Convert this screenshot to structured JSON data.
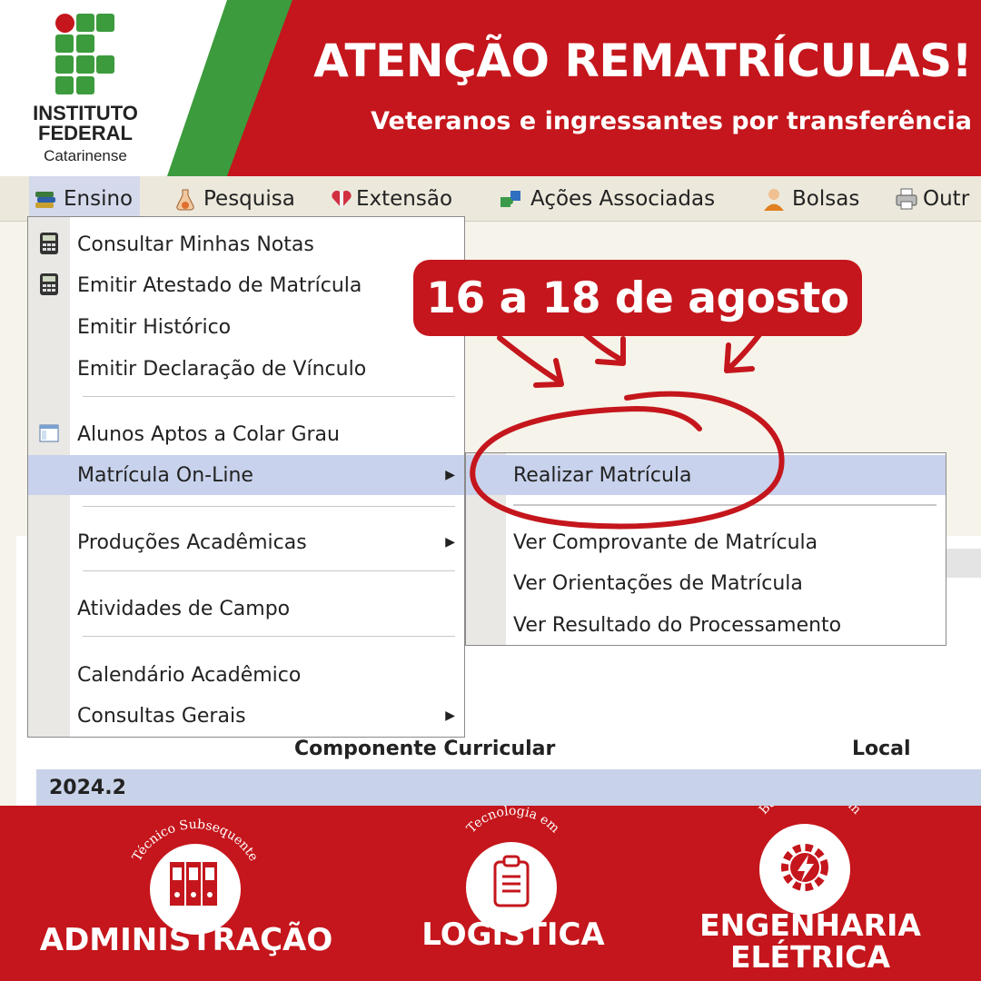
{
  "header": {
    "logo": {
      "line1": "INSTITUTO",
      "line2": "FEDERAL",
      "line3": "Catarinense"
    },
    "title": "ATENÇÃO REMATRÍCULAS!",
    "subtitle": "Veteranos e ingressantes por transferência"
  },
  "colors": {
    "brand_red": "#c4161c",
    "logo_green": "#3c9b3c",
    "menu_highlight": "#c8d2ec"
  },
  "menubar": {
    "items": [
      {
        "label": "Ensino",
        "icon": "books-icon"
      },
      {
        "label": "Pesquisa",
        "icon": "flask-icon"
      },
      {
        "label": "Extensão",
        "icon": "heart-gift-icon"
      },
      {
        "label": "Ações Associadas",
        "icon": "puzzle-icon"
      },
      {
        "label": "Bolsas",
        "icon": "person-icon"
      },
      {
        "label": "Outr",
        "icon": "printer-icon"
      }
    ]
  },
  "ensino_menu": {
    "items": [
      {
        "label": "Consultar Minhas Notas",
        "icon": "calculator-icon"
      },
      {
        "label": "Emitir Atestado de Matrícula",
        "icon": "calculator-icon"
      },
      {
        "label": "Emitir Histórico"
      },
      {
        "label": "Emitir Declaração de Vínculo"
      },
      {
        "label": "Alunos Aptos a Colar Grau",
        "icon": "window-icon"
      },
      {
        "label": "Matrícula On-Line",
        "has_submenu": true,
        "highlighted": true
      },
      {
        "label": "Produções Acadêmicas",
        "has_submenu": true
      },
      {
        "label": "Atividades de Campo"
      },
      {
        "label": "Calendário Acadêmico"
      },
      {
        "label": "Consultas Gerais",
        "has_submenu": true
      }
    ]
  },
  "matricula_submenu": {
    "items": [
      {
        "label": "Realizar Matrícula",
        "highlighted": true
      },
      {
        "label": "Ver Comprovante de Matrícula"
      },
      {
        "label": "Ver Orientações de Matrícula"
      },
      {
        "label": "Ver Resultado do Processamento"
      }
    ]
  },
  "date_badge": "16 a 18 de agosto",
  "table": {
    "columns": [
      "Componente Curricular",
      "Local"
    ],
    "period": "2024.2"
  },
  "courses": [
    {
      "level": "Técnico Subsequente",
      "name": "ADMINISTRAÇÃO",
      "icon": "binders-icon"
    },
    {
      "level": "Tecnologia em",
      "name": "LOGÍSTICA",
      "icon": "clipboard-icon"
    },
    {
      "level": "Bacharelado em",
      "name_line1": "ENGENHARIA",
      "name_line2": "ELÉTRICA",
      "icon": "gear-lightning-icon"
    }
  ]
}
